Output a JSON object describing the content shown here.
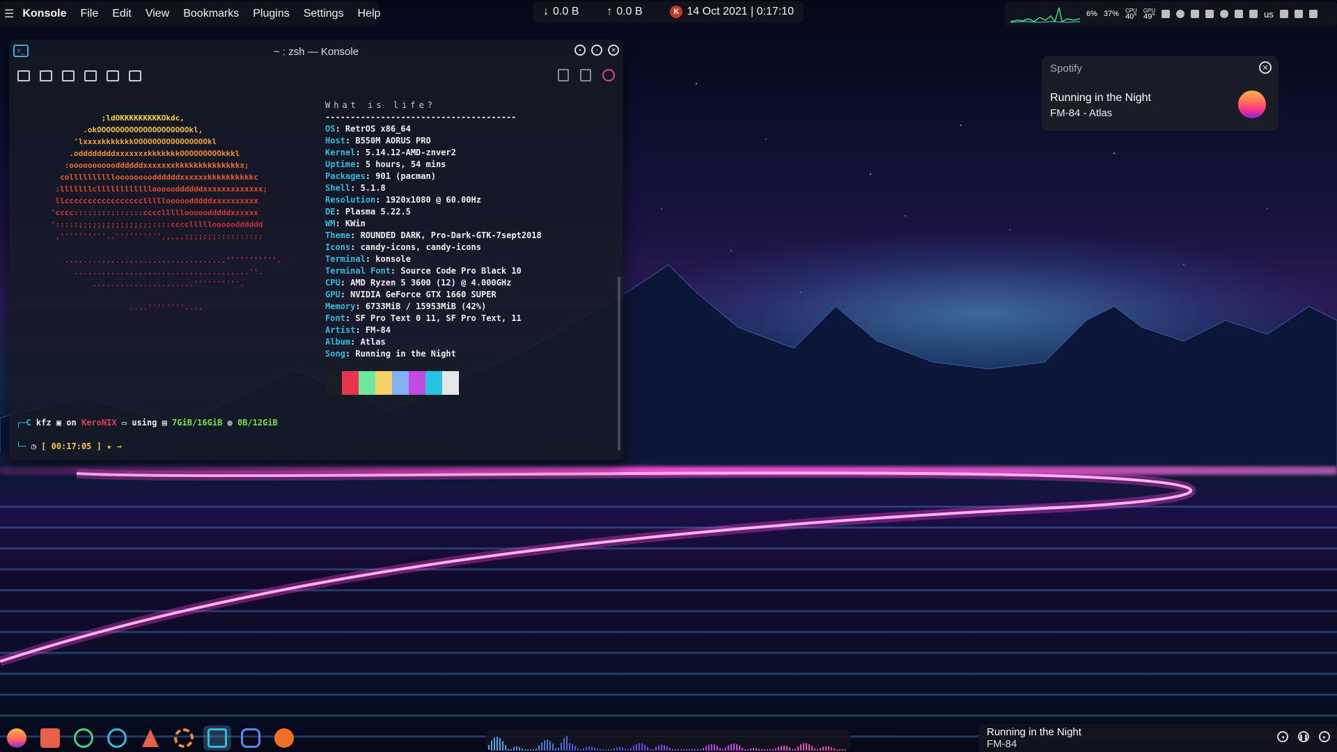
{
  "menubar": {
    "app_name": "Konsole",
    "items": [
      "File",
      "Edit",
      "View",
      "Bookmarks",
      "Plugins",
      "Settings",
      "Help"
    ]
  },
  "center_panel": {
    "down_arrow": "↓",
    "down_value": "0.0 B",
    "up_arrow": "↑",
    "up_value": "0.0 B",
    "k_badge": "K",
    "datetime": "14 Oct 2021 | 0:17:10"
  },
  "tray": {
    "cpu_usage": "6%",
    "mem_usage": "37%",
    "cpu_label": "CPU",
    "cpu_temp": "40°",
    "gpu_label": "GPU",
    "gpu_temp": "49°",
    "language": "us"
  },
  "konsole": {
    "title": "~ : zsh — Konsole",
    "scrollback_progress": 0.55
  },
  "neofetch": {
    "header": "What is life?",
    "separator": "--------------------------------------",
    "fields": [
      {
        "key": "OS",
        "value": "RetrOS x86_64"
      },
      {
        "key": "Host",
        "value": "B550M AORUS PRO"
      },
      {
        "key": "Kernel",
        "value": "5.14.12-AMD-znver2"
      },
      {
        "key": "Uptime",
        "value": "5 hours, 54 mins"
      },
      {
        "key": "Packages",
        "value": "901 (pacman)"
      },
      {
        "key": "Shell",
        "value": "5.1.8"
      },
      {
        "key": "Resolution",
        "value": "1920x1080 @ 60.00Hz"
      },
      {
        "key": "DE",
        "value": "Plasma 5.22.5"
      },
      {
        "key": "WM",
        "value": "KWin"
      },
      {
        "key": "Theme",
        "value": "ROUNDED DARK, Pro-Dark-GTK-7sept2018"
      },
      {
        "key": "Icons",
        "value": "candy-icons, candy-icons"
      },
      {
        "key": "Terminal",
        "value": "konsole"
      },
      {
        "key": "Terminal Font",
        "value": "Source Code Pro Black 10"
      },
      {
        "key": "CPU",
        "value": "AMD Ryzen 5 3600 (12) @ 4.000GHz"
      },
      {
        "key": "GPU",
        "value": "NVIDIA GeForce GTX 1660 SUPER"
      },
      {
        "key": "Memory",
        "value": "6733MiB / 15953MiB (42%)"
      },
      {
        "key": "Font",
        "value": "SF Pro Text 0 11, SF Pro Text, 11"
      },
      {
        "key": "Artist",
        "value": "FM-84"
      },
      {
        "key": "Album",
        "value": "Atlas"
      },
      {
        "key": "Song",
        "value": "Running in the Night"
      }
    ],
    "palette": [
      "#1a1d24",
      "#e8344e",
      "#6ee7a0",
      "#f4d264",
      "#7fb0f0",
      "#c24ae0",
      "#25c4e0",
      "#e6e6e6"
    ],
    "ascii_lines": [
      "              ;ldOKKKKKKKKKOkdc,",
      "          .okOOOOOOOOOOOOOOOOOOOOkl,",
      "        'lxxxxkkkkkkkOOOOOOOOOOOOOOOOkl",
      "       .oddddddddxxxxxxxkkkkkkkOOOOOOOOOkkkl",
      "      :ooooooooooddddddxxxxxxxkkkkkkkkkkkkkkx;",
      "     collllllllllooooooooddddddxxxxxxkkkkkkkkkkc",
      "    :lllllllclllllllllllloooooddddddxxxxxxxxxxxxx;",
      "    llccccccccccccccccclllllooooodddddxxxxxxxxxx",
      "   'cccc:::::::::::::::cccclllllooooodddddxxxxxx",
      "   ':::::;;;;;;;;;;;;;;;;::::cccclllllooooodddddd",
      "    ,''''''''''..'''''''''',,,,,;;;;;;;::::::::::",
      "",
      "      ...................................'''''''''''.",
      "        ......................................''.",
      "            ......................''''''''''.",
      "",
      "                    ....''''''''...."
    ]
  },
  "prompt": {
    "user": "kfz",
    "on": "on",
    "host": "KeroNIX",
    "using": "using",
    "mem": "7GiB/16GiB",
    "swap": "0B/12GiB",
    "time": "[ 00:17:05 ]",
    "arrow": "→"
  },
  "notification": {
    "app": "Spotify",
    "title": "Running in the Night",
    "subtitle": "FM-84 - Atlas"
  },
  "dock": {
    "items": [
      "launcher",
      "files",
      "spotify",
      "store",
      "installer",
      "settings",
      "konsole",
      "discord",
      "brave"
    ]
  },
  "now_playing": {
    "title": "Running in the Night",
    "artist": "FM-84"
  },
  "colors": {
    "accent_cyan": "#33bbdd",
    "accent_red": "#e43b5a",
    "neon_pink": "#ff40d0"
  }
}
